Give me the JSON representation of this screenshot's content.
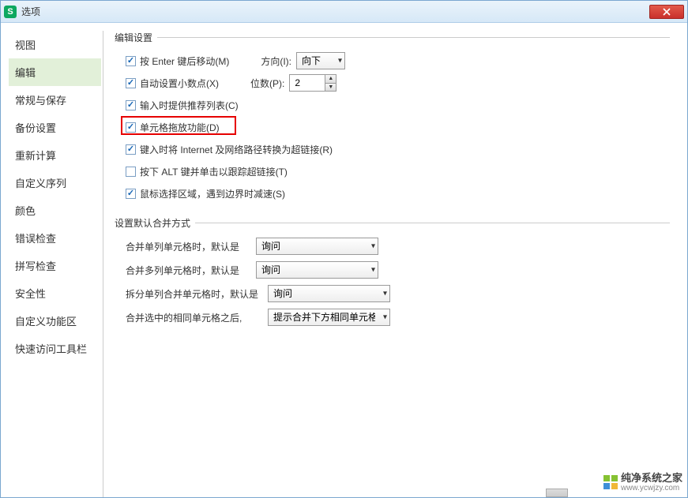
{
  "window": {
    "title": "选项"
  },
  "sidebar": {
    "items": [
      {
        "label": "视图"
      },
      {
        "label": "编辑",
        "active": true
      },
      {
        "label": "常规与保存"
      },
      {
        "label": "备份设置"
      },
      {
        "label": "重新计算"
      },
      {
        "label": "自定义序列"
      },
      {
        "label": "颜色"
      },
      {
        "label": "错误检查"
      },
      {
        "label": "拼写检查"
      },
      {
        "label": "安全性"
      },
      {
        "label": "自定义功能区"
      },
      {
        "label": "快速访问工具栏"
      }
    ]
  },
  "edit_settings": {
    "group_title": "编辑设置",
    "enter_move": {
      "checked": true,
      "label": "按 Enter 键后移动(M)",
      "dir_label": "方向(I):",
      "dir_value": "向下"
    },
    "auto_decimal": {
      "checked": true,
      "label": "自动设置小数点(X)",
      "digits_label": "位数(P):",
      "digits_value": "2"
    },
    "suggest_list": {
      "checked": true,
      "label": "输入时提供推荐列表(C)"
    },
    "cell_drag": {
      "checked": true,
      "label": "单元格拖放功能(D)"
    },
    "inet_link": {
      "checked": true,
      "label": "键入时将 Internet 及网络路径转换为超链接(R)"
    },
    "alt_click": {
      "checked": false,
      "label": "按下 ALT 键并单击以跟踪超链接(T)"
    },
    "mouse_slow": {
      "checked": true,
      "label": "鼠标选择区域，遇到边界时减速(S)"
    }
  },
  "merge_settings": {
    "group_title": "设置默认合并方式",
    "rows": [
      {
        "label": "合并单列单元格时，默认是",
        "value": "询问"
      },
      {
        "label": "合并多列单元格时，默认是",
        "value": "询问"
      },
      {
        "label": "拆分单列合并单元格时，默认是",
        "value": "询问"
      },
      {
        "label": "合并选中的相同单元格之后,",
        "value": "提示合并下方相同单元格"
      }
    ]
  },
  "watermark": {
    "text": "纯净系统之家",
    "url": "www.ycwjzy.com"
  }
}
